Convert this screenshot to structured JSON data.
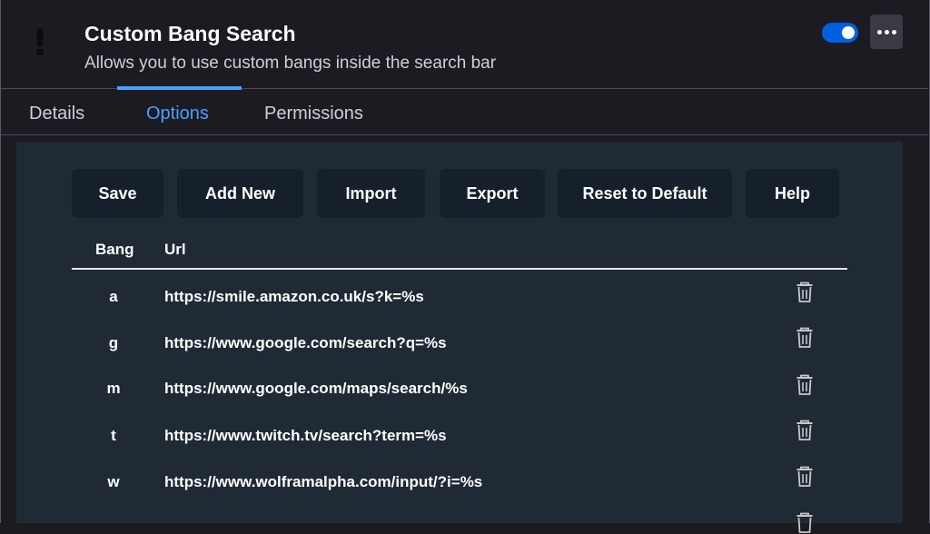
{
  "addon": {
    "icon": "!",
    "title": "Custom Bang Search",
    "description": "Allows you to use custom bangs inside the search bar",
    "enabled": true
  },
  "tabs": [
    {
      "label": "Details",
      "active": false
    },
    {
      "label": "Options",
      "active": true
    },
    {
      "label": "Permissions",
      "active": false
    }
  ],
  "toolbar": {
    "save": "Save",
    "add_new": "Add New",
    "import": "Import",
    "export": "Export",
    "reset": "Reset to Default",
    "help": "Help"
  },
  "table": {
    "headers": {
      "bang": "Bang",
      "url": "Url"
    },
    "rows": [
      {
        "bang": "a",
        "url": "https://smile.amazon.co.uk/s?k=%s"
      },
      {
        "bang": "g",
        "url": "https://www.google.com/search?q=%s"
      },
      {
        "bang": "m",
        "url": "https://www.google.com/maps/search/%s"
      },
      {
        "bang": "t",
        "url": "https://www.twitch.tv/search?term=%s"
      },
      {
        "bang": "w",
        "url": "https://www.wolframalpha.com/input/?i=%s"
      }
    ]
  },
  "colors": {
    "accent": "#45a1ff",
    "toggle": "#0060df",
    "panel_bg": "#1f2a35",
    "button_bg": "#15202b"
  },
  "icons": {
    "more": "more-horizontal-icon",
    "delete": "trash-icon"
  }
}
